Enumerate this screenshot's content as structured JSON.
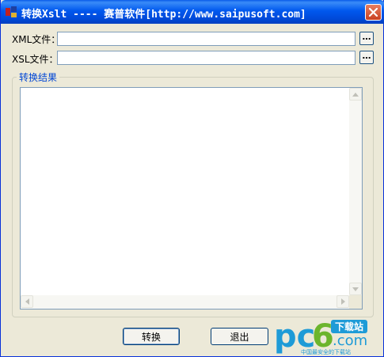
{
  "window": {
    "title": "转换Xslt ---- 赛普软件[http://www.saipusoft.com]"
  },
  "form": {
    "xml_label": "XML文件：",
    "xml_value": "",
    "xsl_label": "XSL文件：",
    "xsl_value": "",
    "browse_label": "…"
  },
  "result_group": {
    "title": "转换结果",
    "content": ""
  },
  "buttons": {
    "convert_label": "转换",
    "exit_label": "退出"
  },
  "watermark": {
    "logo_text": "pc6.com",
    "badge_text": "下载站",
    "tagline": "中国最安全的下载站"
  },
  "colors": {
    "titlebar": "#0058EE",
    "dialog_bg": "#ECE9D8",
    "group_title": "#0046D5",
    "watermark_blue": "#1E9BD7",
    "watermark_green": "#6CB52D"
  }
}
